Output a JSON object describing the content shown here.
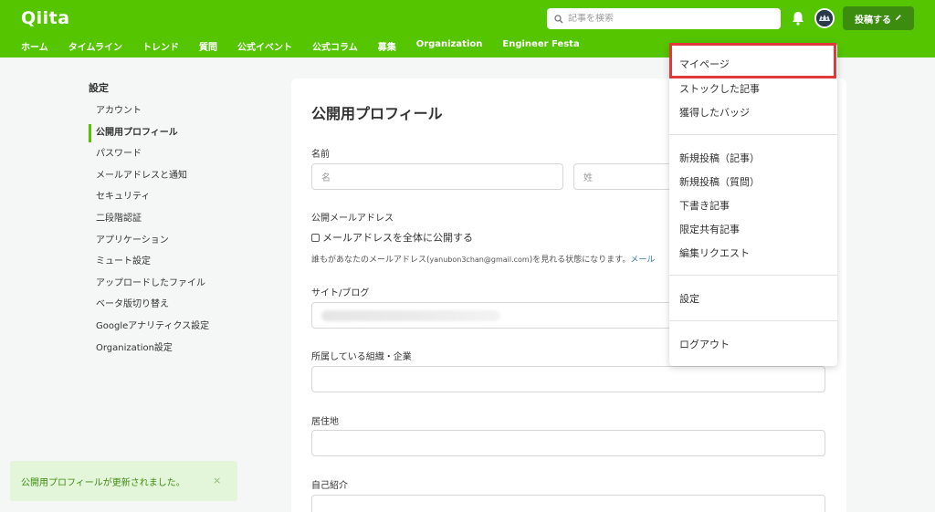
{
  "header": {
    "logo": "Qiita",
    "search_placeholder": "記事を検索",
    "post_button": "投稿する",
    "nav": [
      "ホーム",
      "タイムライン",
      "トレンド",
      "質問",
      "公式イベント",
      "公式コラム",
      "募集",
      "Organization",
      "Engineer Festa"
    ]
  },
  "sidebar": {
    "title": "設定",
    "items": [
      "アカウント",
      "公開用プロフィール",
      "パスワード",
      "メールアドレスと通知",
      "セキュリティ",
      "二段階認証",
      "アプリケーション",
      "ミュート設定",
      "アップロードしたファイル",
      "ベータ版切り替え",
      "Googleアナリティクス設定",
      "Organization設定"
    ],
    "active_index": 1
  },
  "form": {
    "title": "公開用プロフィール",
    "name_label": "名前",
    "first_name_placeholder": "名",
    "last_name_placeholder": "姓",
    "email_label": "公開メールアドレス",
    "email_checkbox_label": "メールアドレスを全体に公開する",
    "email_hint_before": "誰もがあなたのメールアドレス(",
    "email_hint_address": "yanubon3chan@gmail.com",
    "email_hint_after": ")を見れる状態になります。",
    "email_hint_link": "メール",
    "site_label": "サイト/ブログ",
    "org_label": "所属している組織・企業",
    "location_label": "居住地",
    "bio_label": "自己紹介"
  },
  "dropdown": {
    "items_group1": [
      "マイページ",
      "ストックした記事",
      "獲得したバッジ"
    ],
    "items_group2": [
      "新規投稿（記事）",
      "新規投稿（質問）",
      "下書き記事",
      "限定共有記事",
      "編集リクエスト"
    ],
    "items_group3": [
      "設定"
    ],
    "items_group4": [
      "ログアウト"
    ]
  },
  "toast": {
    "message": "公開用プロフィールが更新されました。",
    "close": "×"
  },
  "colors": {
    "brand": "#55c500",
    "highlight": "#e0383b"
  }
}
